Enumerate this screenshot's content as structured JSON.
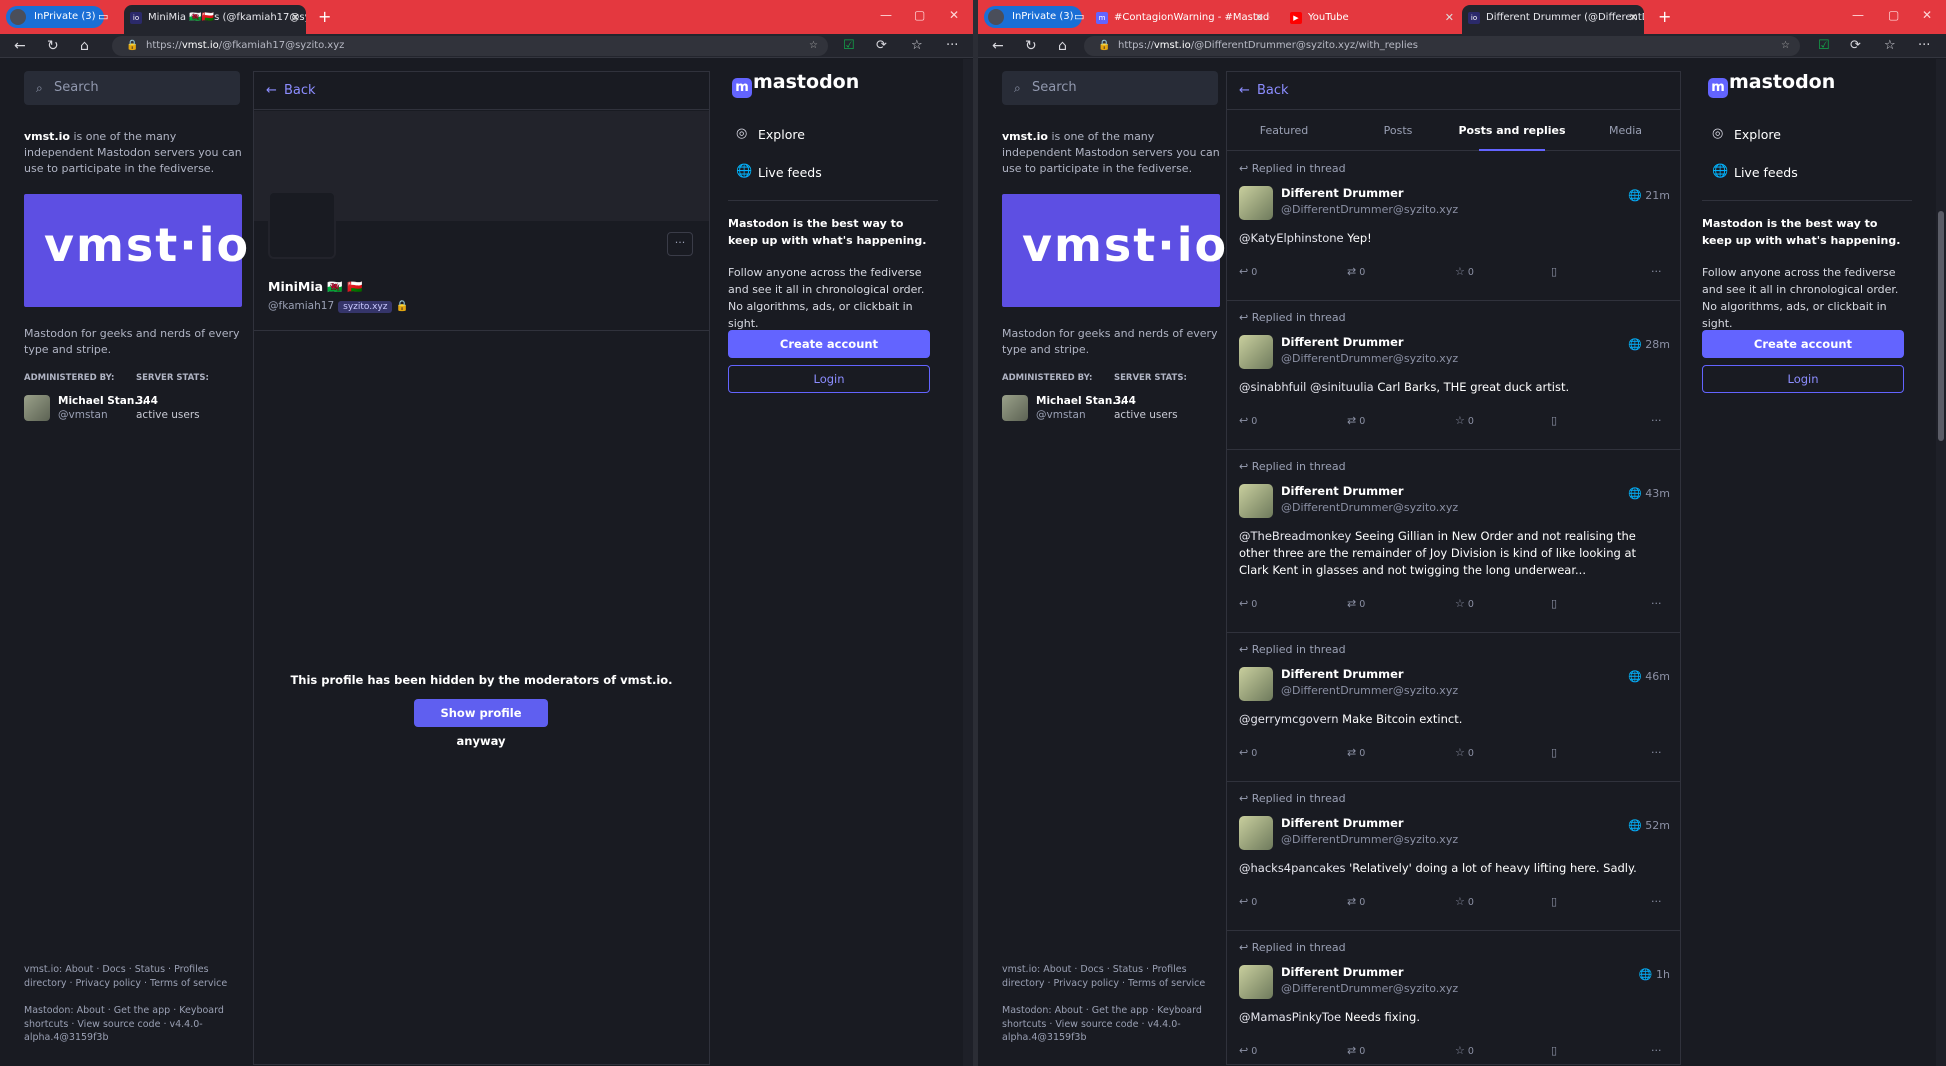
{
  "left": {
    "tabs": {
      "inprivate": "InPrivate (3)",
      "active_title": "MiniMia 🏴󠁧󠁢󠁷󠁬󠁳󠁿🇴🇲s (@fkamiah17@syz"
    },
    "url": {
      "prefix": "https://",
      "domain": "vmst.io",
      "path": "/@fkamiah17@syzito.xyz"
    },
    "sidebar": {
      "search_placeholder": "Search",
      "about_server": "vmst.io",
      "about_text": " is one of the many independent Mastodon servers you can use to participate in the fediverse.",
      "banner_logo": "vmst·io",
      "description": "Mastodon for geeks and nerds of every type and stripe.",
      "admin_label": "ADMINISTERED BY:",
      "stats_label": "SERVER STATS:",
      "admin_name": "Michael Stan...",
      "admin_handle": "@vmstan",
      "stat_value": "344",
      "stat_unit": "active users",
      "footer_server": "vmst.io: About · Docs · Status · Profiles directory · Privacy policy · Terms of service",
      "footer_mastodon": "Mastodon: About · Get the app · Keyboard shortcuts · View source code · v4.4.0-alpha.4@3159f3b"
    },
    "column": {
      "back_label": "Back",
      "profile_name": "MiniMia 🏴󠁧󠁢󠁷󠁬󠁳󠁿 🇴🇲",
      "profile_handle": "@fkamiah17",
      "profile_domain": "syzito.xyz",
      "lock_icon": "🔒",
      "more_label": "···",
      "hidden_message": "This profile has been hidden by the moderators of vmst.io.",
      "show_button": "Show profile anyway"
    },
    "nav": {
      "logo": "mastodon",
      "explore": "Explore",
      "live_feeds": "Live feeds",
      "pitch": "Mastodon is the best way to keep up with what's happening.",
      "pitch2": "Follow anyone across the fediverse and see it all in chronological order. No algorithms, ads, or clickbait in sight.",
      "create_account": "Create account",
      "login": "Login"
    }
  },
  "right": {
    "tabs": {
      "inprivate": "InPrivate (3)",
      "tab2": "#ContagionWarning - #Mastodo",
      "tab3": "YouTube",
      "tab4": "Different Drummer (@DifferentD"
    },
    "url": {
      "prefix": "https://",
      "domain": "vmst.io",
      "path": "/@DifferentDrummer@syzito.xyz/with_replies"
    },
    "column": {
      "back_label": "Back",
      "tab_featured": "Featured",
      "tab_posts": "Posts",
      "tab_replies": "Posts and replies",
      "tab_media": "Media",
      "posts": [
        {
          "replied": "Replied in thread",
          "name": "Different Drummer",
          "handle": "@DifferentDrummer@syzito.xyz",
          "time": "21m",
          "mention": "@KatyElphinstone",
          "text": " Yep!",
          "reply_count": "0",
          "boost_count": "0",
          "fav_count": "0"
        },
        {
          "replied": "Replied in thread",
          "name": "Different Drummer",
          "handle": "@DifferentDrummer@syzito.xyz",
          "time": "28m",
          "mention": "@sinabhfuil @sinituulia",
          "text": "  Carl Barks, THE great duck artist.",
          "reply_count": "0",
          "boost_count": "0",
          "fav_count": "0"
        },
        {
          "replied": "Replied in thread",
          "name": "Different Drummer",
          "handle": "@DifferentDrummer@syzito.xyz",
          "time": "43m",
          "mention": "@TheBreadmonkey",
          "text": " Seeing Gillian in New Order and not realising the other three are the remainder of Joy Division is kind of like looking at Clark Kent in glasses and not twigging the long underwear...",
          "reply_count": "0",
          "boost_count": "0",
          "fav_count": "0"
        },
        {
          "replied": "Replied in thread",
          "name": "Different Drummer",
          "handle": "@DifferentDrummer@syzito.xyz",
          "time": "46m",
          "mention": "@gerrymcgovern",
          "text": " Make Bitcoin extinct.",
          "reply_count": "0",
          "boost_count": "0",
          "fav_count": "0"
        },
        {
          "replied": "Replied in thread",
          "name": "Different Drummer",
          "handle": "@DifferentDrummer@syzito.xyz",
          "time": "52m",
          "mention": "@hacks4pancakes",
          "text": " 'Relatively' doing a lot of heavy lifting here. Sadly.",
          "reply_count": "0",
          "boost_count": "0",
          "fav_count": "0"
        },
        {
          "replied": "Replied in thread",
          "name": "Different Drummer",
          "handle": "@DifferentDrummer@syzito.xyz",
          "time": "1h",
          "mention": "@MamasPinkyToe",
          "text": " Needs fixing.",
          "reply_count": "0",
          "boost_count": "0",
          "fav_count": "0"
        }
      ]
    }
  },
  "colors": {
    "accent": "#6364ff",
    "titlebar": "#e4383f",
    "background": "#191b22"
  }
}
